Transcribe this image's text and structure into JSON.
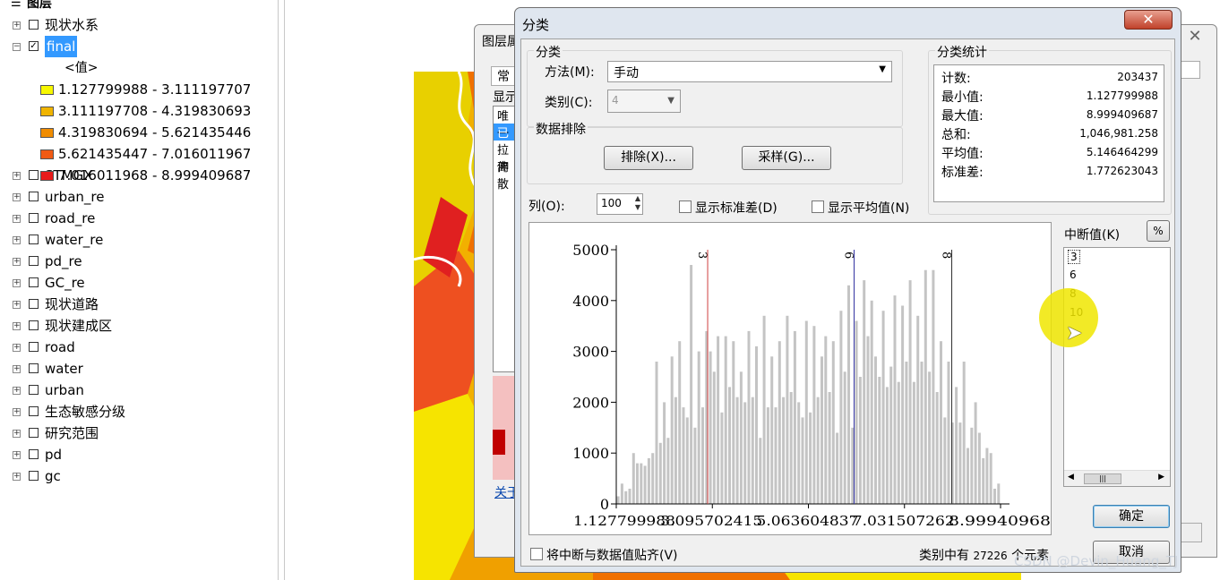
{
  "toc": {
    "header": "图层",
    "items": [
      {
        "name": "现状水系",
        "checked": false
      },
      {
        "name": "final",
        "checked": true,
        "selected": true
      },
      {
        "name": "STMGX",
        "checked": false
      },
      {
        "name": "urban_re",
        "checked": false
      },
      {
        "name": "road_re",
        "checked": false
      },
      {
        "name": "water_re",
        "checked": false
      },
      {
        "name": "pd_re",
        "checked": false
      },
      {
        "name": "GC_re",
        "checked": false
      },
      {
        "name": "现状道路",
        "checked": false
      },
      {
        "name": "现状建成区",
        "checked": false
      },
      {
        "name": "road",
        "checked": false
      },
      {
        "name": "water",
        "checked": false
      },
      {
        "name": "urban",
        "checked": false
      },
      {
        "name": "生态敏感分级",
        "checked": false
      },
      {
        "name": "研究范围",
        "checked": false
      },
      {
        "name": "pd",
        "checked": false
      },
      {
        "name": "gc",
        "checked": false
      }
    ],
    "value_header": "<值>",
    "legend": [
      {
        "label": "1.127799988 - 3.111197707",
        "color": "#f7f700"
      },
      {
        "label": "3.111197708 - 4.319830693",
        "color": "#f0b400"
      },
      {
        "label": "4.319830694 - 5.621435446",
        "color": "#f08c00"
      },
      {
        "label": "5.621435447 - 7.016011967",
        "color": "#f05a14"
      },
      {
        "label": "7.016011968 - 8.999409687",
        "color": "#e81a1a"
      }
    ]
  },
  "bg_dialog": {
    "title": "图层属",
    "tab": "常规",
    "list_header": "显示",
    "list_items": [
      "唯一",
      "已分",
      "拉伸",
      "离散"
    ],
    "link": "关于"
  },
  "dialog": {
    "title": "分类",
    "classification_group": "分类",
    "method_label": "方法(M):",
    "method_value": "手动",
    "classes_label": "类别(C):",
    "classes_value": "4",
    "exclusion_group": "数据排除",
    "exclude_button": "排除(X)...",
    "sample_button": "采样(G)...",
    "stats_group": "分类统计",
    "stats": [
      {
        "label": "计数:",
        "value": "203437"
      },
      {
        "label": "最小值:",
        "value": "1.127799988"
      },
      {
        "label": "最大值:",
        "value": "8.999409687"
      },
      {
        "label": "总和:",
        "value": "1,046,981.258"
      },
      {
        "label": "平均值:",
        "value": "5.146464299"
      },
      {
        "label": "标准差:",
        "value": "1.772623043"
      }
    ],
    "columns_label": "列(O):",
    "columns_value": "100",
    "show_std_label": "显示标准差(D)",
    "show_mean_label": "显示平均值(N)",
    "break_values_label": "中断值(K)",
    "percent_button": "%",
    "break_values": [
      "3",
      "6",
      "8",
      "10"
    ],
    "snap_label": "将中断与数据值贴齐(V)",
    "elements_text": "类别中有",
    "elements_count": "27226",
    "elements_suffix": "个元素",
    "ok_button": "确定",
    "cancel_button": "取消",
    "close_glyph": "✕"
  },
  "watermark": "CSDN @Devin_Huang_TJ",
  "chart_data": {
    "type": "bar",
    "y_ticks": [
      "5000",
      "4000",
      "3000",
      "2000",
      "1000",
      "0"
    ],
    "x_ticks": [
      "1.127799988",
      "3.095702415",
      "5.063604837",
      "7.031507262",
      "8.99940968"
    ],
    "ylim": [
      0,
      5000
    ],
    "xlim": [
      1.127799988,
      8.999409687
    ],
    "breaks": [
      {
        "label": "3",
        "value": 3.0,
        "color": "#d04040"
      },
      {
        "label": "6",
        "value": 6.0,
        "color": "#3030a0"
      },
      {
        "label": "8",
        "value": 8.0,
        "color": "#303030"
      }
    ],
    "values": [
      150,
      400,
      250,
      300,
      1000,
      800,
      800,
      750,
      900,
      1000,
      2800,
      1200,
      2000,
      1300,
      2900,
      2100,
      3200,
      1900,
      1700,
      4700,
      1500,
      3000,
      1900,
      3400,
      3000,
      2600,
      3300,
      1800,
      3300,
      2300,
      3200,
      2100,
      2600,
      2000,
      3400,
      2100,
      3100,
      1300,
      3700,
      1900,
      2900,
      1900,
      3200,
      2100,
      3700,
      2200,
      3400,
      2000,
      1700,
      3600,
      1800,
      3500,
      2100,
      2900,
      3300,
      2200,
      3200,
      1400,
      3800,
      2600,
      4300,
      1500,
      3600,
      2500,
      4400,
      3300,
      4000,
      2900,
      2500,
      3800,
      2300,
      2700,
      4100,
      2400,
      3900,
      2800,
      4400,
      2400,
      3700,
      2800,
      4600,
      2600,
      4600,
      2200,
      3200,
      1700,
      2800,
      1600,
      2300,
      1600,
      2800,
      1100,
      1500,
      2000,
      1400,
      900,
      1100,
      1000,
      300,
      400
    ]
  }
}
